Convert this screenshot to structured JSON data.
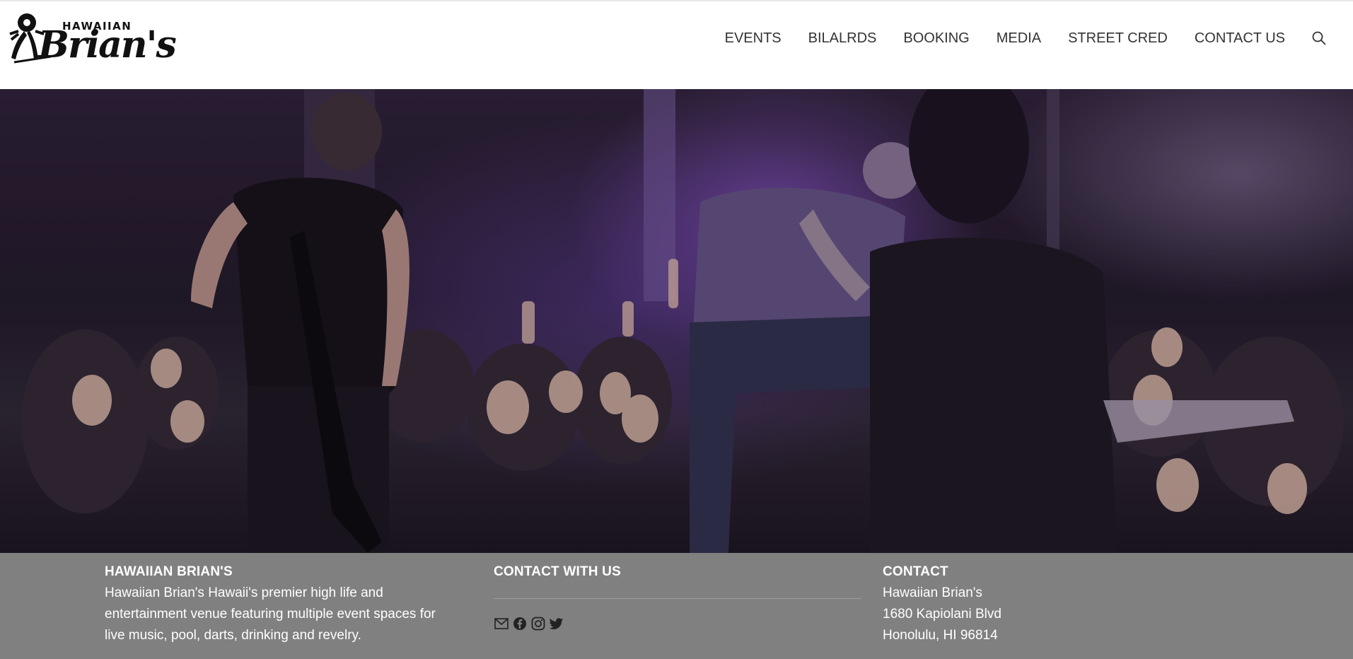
{
  "brand": {
    "logo_top": "HAWAIIAN",
    "logo_main": "Brian's"
  },
  "nav": {
    "items": [
      "EVENTS",
      "BILALRDS",
      "BOOKING",
      "MEDIA",
      "STREET CRED",
      "CONTACT US"
    ],
    "search_icon": "search-icon"
  },
  "hero": {
    "image": "concert-crowd-photo",
    "accent_color": "#7a4fc0"
  },
  "footer": {
    "background": "#808080",
    "about": {
      "title": "HAWAIIAN BRIAN'S",
      "text_lines": [
        "Hawaiian Brian's Hawaii's premier high life and",
        "entertainment venue featuring multiple event spaces for",
        "live music, pool, darts, drinking and revelry."
      ]
    },
    "connect": {
      "title": "CONTACT WITH US",
      "icons": [
        "email-icon",
        "facebook-icon",
        "instagram-icon",
        "twitter-icon"
      ]
    },
    "contact": {
      "title": "CONTACT",
      "lines": [
        "Hawaiian Brian's",
        "1680 Kapiolani Blvd",
        "Honolulu, HI 96814"
      ]
    }
  }
}
